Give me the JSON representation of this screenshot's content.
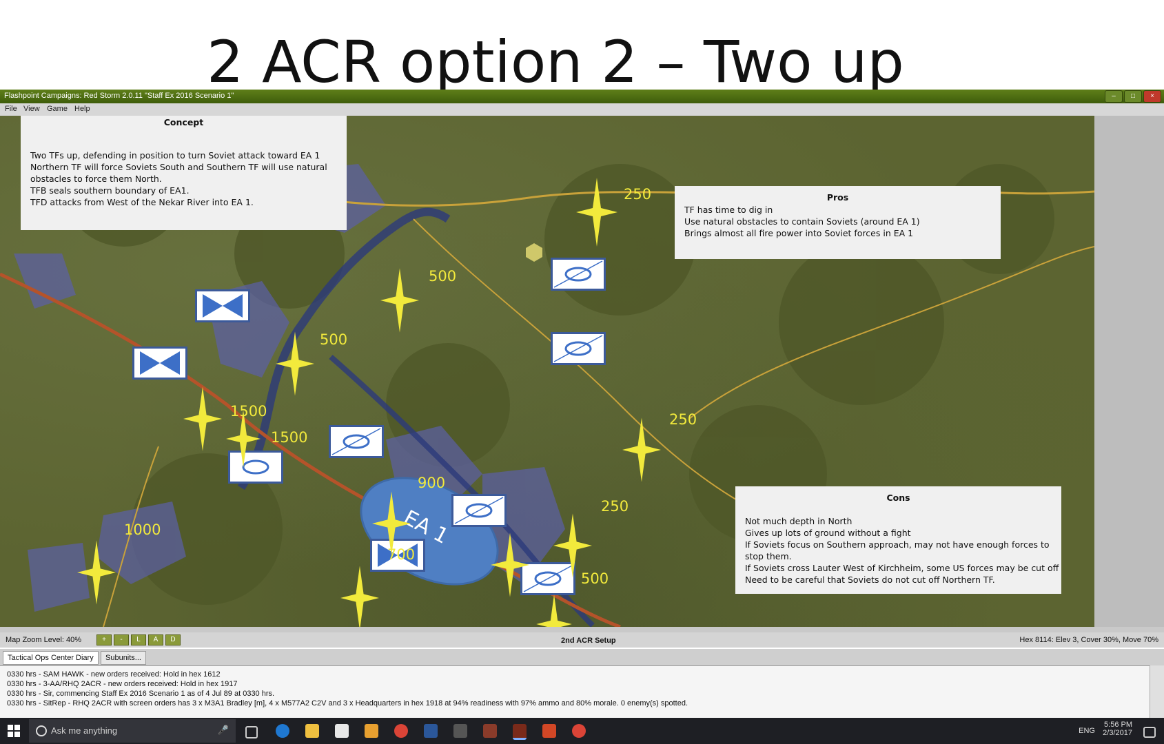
{
  "slide": {
    "title": "2 ACR option 2 – Two up"
  },
  "window": {
    "title": "Flashpoint Campaigns: Red Storm  2.0.11  \"Staff Ex 2016 Scenario 1\"",
    "menu": [
      "File",
      "View",
      "Game",
      "Help"
    ]
  },
  "concept": {
    "title": "Concept",
    "lines": [
      "Two TFs up, defending in position to turn Soviet attack toward EA 1",
      "Northern TF will force Soviets South and Southern TF will use natural",
      "obstacles to force them North.",
      "TFB seals southern boundary of EA1.",
      "TFD attacks from West of the Nekar River into EA 1."
    ]
  },
  "pros": {
    "title": "Pros",
    "lines": [
      "TF has time to dig in",
      "Use natural obstacles to contain Soviets (around EA 1)",
      "Brings almost all fire power into Soviet forces in EA 1"
    ]
  },
  "cons": {
    "title": "Cons",
    "lines": [
      "Not much depth in North",
      "Gives up lots of ground without a fight",
      "If Soviets focus on Southern approach, may not have enough forces to",
      "stop them.",
      "If Soviets cross Lauter West of Kirchheim, some US forces may be cut off",
      "Need to be careful that Soviets do not cut off Northern TF."
    ]
  },
  "engagement_area": {
    "label": "EA 1"
  },
  "fire_markers": [
    "250",
    "500",
    "500",
    "1500",
    "1500",
    "250",
    "900",
    "250",
    "1000",
    "700",
    "500"
  ],
  "status": {
    "zoom_label": "Map Zoom Level: 40%",
    "zoom_buttons": [
      "+",
      "-",
      "L",
      "A",
      "D"
    ],
    "setup_label": "2nd ACR Setup",
    "hex_info": "Hex 8114: Elev 3, Cover 30%, Move 70%"
  },
  "tabs": [
    "Tactical Ops Center Diary",
    "Subunits..."
  ],
  "diary": [
    "0330 hrs - SAM HAWK - new orders received: Hold in hex 1612",
    "0330 hrs - 3-AA/RHQ 2ACR - new orders received: Hold in hex 1917",
    "0330 hrs - Sir, commencing Staff Ex 2016 Scenario 1 as of 4 Jul 89 at 0330 hrs.",
    "0330 hrs - SitRep - RHQ 2ACR with screen orders has 3 x M3A1 Bradley [m], 4 x M577A2 C2V and 3 x Headquarters in hex 1918 at 94% readiness with 97% ammo and 80% morale.  0 enemy(s) spotted."
  ],
  "taskbar": {
    "search_placeholder": "Ask me anything",
    "lang": "ENG",
    "time": "5:56 PM",
    "date": "2/3/2017",
    "icons": [
      "windows-start-icon",
      "task-view-icon",
      "edge-icon",
      "file-explorer-icon",
      "store-icon",
      "paint-icon",
      "chrome-icon",
      "word-icon",
      "game-icon",
      "game-icon-2",
      "flashpoint-icon",
      "powerpoint-icon",
      "chrome-icon-2"
    ]
  },
  "colors": {
    "titlebar": "#4a6b10",
    "marker": "#f2ea3c",
    "unit_border": "#3c5a9a",
    "ea_fill": "#4f7fc3"
  }
}
